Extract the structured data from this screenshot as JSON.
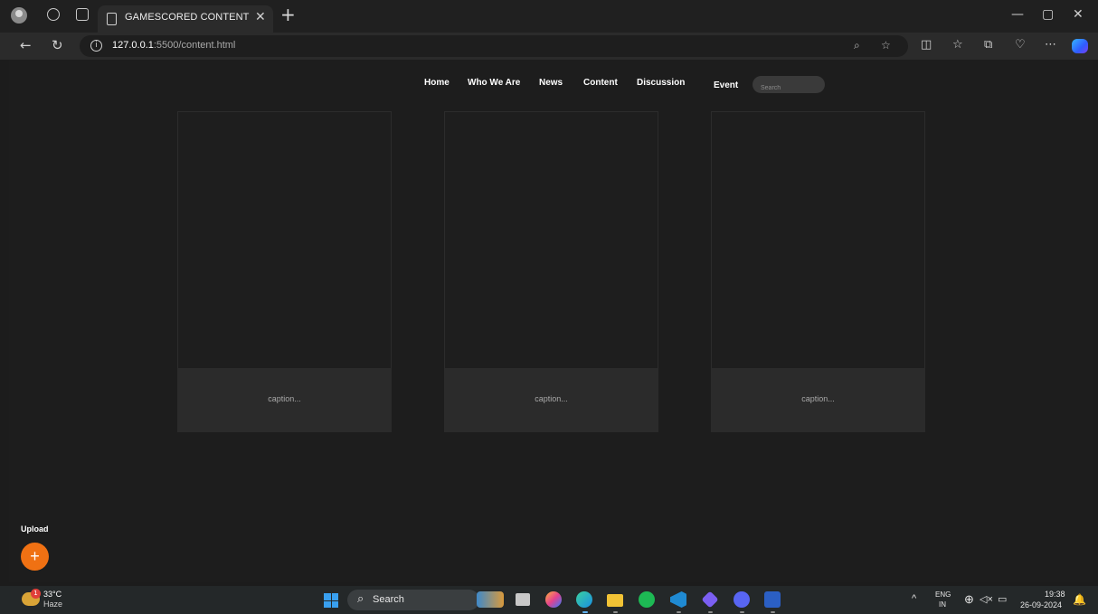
{
  "browser": {
    "tab_title": "GAMESCORED CONTENT",
    "url_host": "127.0.0.1",
    "url_path": ":5500/content.html"
  },
  "nav": {
    "items": [
      "Home",
      "Who We Are",
      "News",
      "Content",
      "Discussion",
      "Event"
    ],
    "search_placeholder": "Search"
  },
  "cards": [
    {
      "caption": "caption..."
    },
    {
      "caption": "caption..."
    },
    {
      "caption": "caption..."
    }
  ],
  "upload": {
    "label": "Upload",
    "button_symbol": "+"
  },
  "taskbar": {
    "weather_badge": "1",
    "temperature": "33°C",
    "condition": "Haze",
    "search_label": "Search",
    "language": "ENG",
    "region": "IN",
    "time": "19:38",
    "date": "26-09-2024"
  },
  "colors": {
    "page_bg": "#1d1d1d",
    "caption_bg": "#2b2b2b",
    "accent": "#f07113"
  }
}
